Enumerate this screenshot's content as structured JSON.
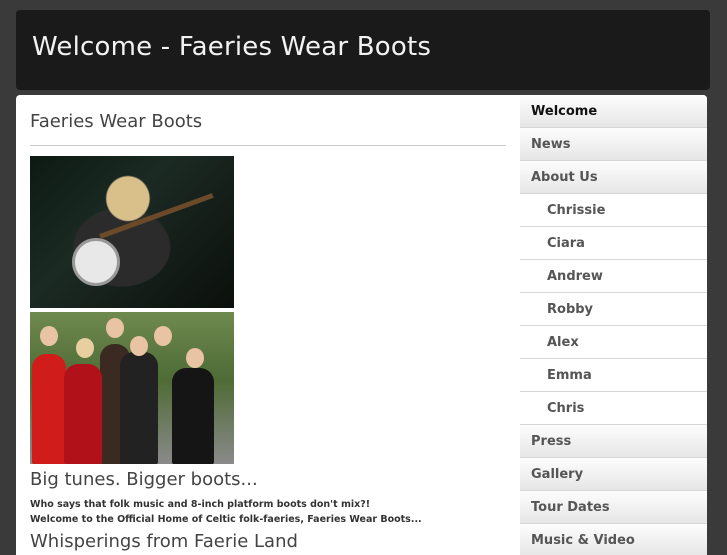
{
  "header": {
    "title": "Welcome - Faeries Wear Boots"
  },
  "content": {
    "page_title": "Faeries Wear Boots",
    "tagline": "Big tunes. Bigger boots...",
    "intro_lines": [
      "Who says that folk music and 8-inch platform boots don't mix?!",
      "Welcome to the Official Home of Celtic folk-faeries, Faeries Wear Boots..."
    ],
    "sub_heading": "Whisperings from Faerie Land"
  },
  "nav": {
    "items": [
      {
        "label": "Welcome",
        "level": "top",
        "active": true
      },
      {
        "label": "News",
        "level": "top"
      },
      {
        "label": "About Us",
        "level": "top"
      },
      {
        "label": "Chrissie",
        "level": "sub"
      },
      {
        "label": "Ciara",
        "level": "sub"
      },
      {
        "label": "Andrew",
        "level": "sub"
      },
      {
        "label": "Robby",
        "level": "sub"
      },
      {
        "label": "Alex",
        "level": "sub"
      },
      {
        "label": "Emma",
        "level": "sub"
      },
      {
        "label": "Chris",
        "level": "sub"
      },
      {
        "label": "Press",
        "level": "top"
      },
      {
        "label": "Gallery",
        "level": "top"
      },
      {
        "label": "Tour Dates",
        "level": "top"
      },
      {
        "label": "Music & Video",
        "level": "top"
      }
    ]
  },
  "colors": {
    "header_bg": "#1a1a1a",
    "page_bg": "#3a3a3a"
  }
}
